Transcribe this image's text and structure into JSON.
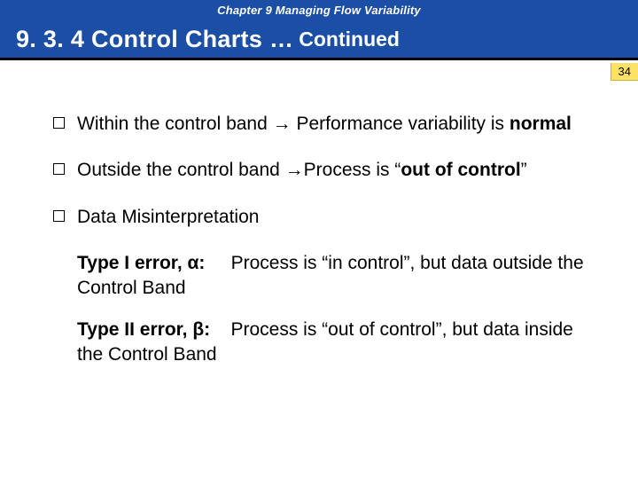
{
  "header": {
    "chapter": "Chapter 9  Managing Flow Variability",
    "title_main": "9. 3. 4 Control Charts …",
    "title_sub": "Continued"
  },
  "page_number": "34",
  "bullets": [
    {
      "pre": "Within the control band ",
      "arrow": "→",
      "mid": " Performance variability is ",
      "bold_tail": "normal"
    },
    {
      "pre": "Outside the control band ",
      "arrow": "→",
      "mid": "Process is ",
      "q1": "“",
      "bold_tail": "out of control",
      "q2": "”"
    },
    {
      "plain": "Data Misinterpretation"
    }
  ],
  "errors": {
    "type1_label": "Type I error, α:",
    "type1_text": "Process is “in control”, but data outside the Control Band",
    "type2_label": "Type II error, β:",
    "type2_text": "Process is “out of control”, but data inside the Control Band"
  }
}
